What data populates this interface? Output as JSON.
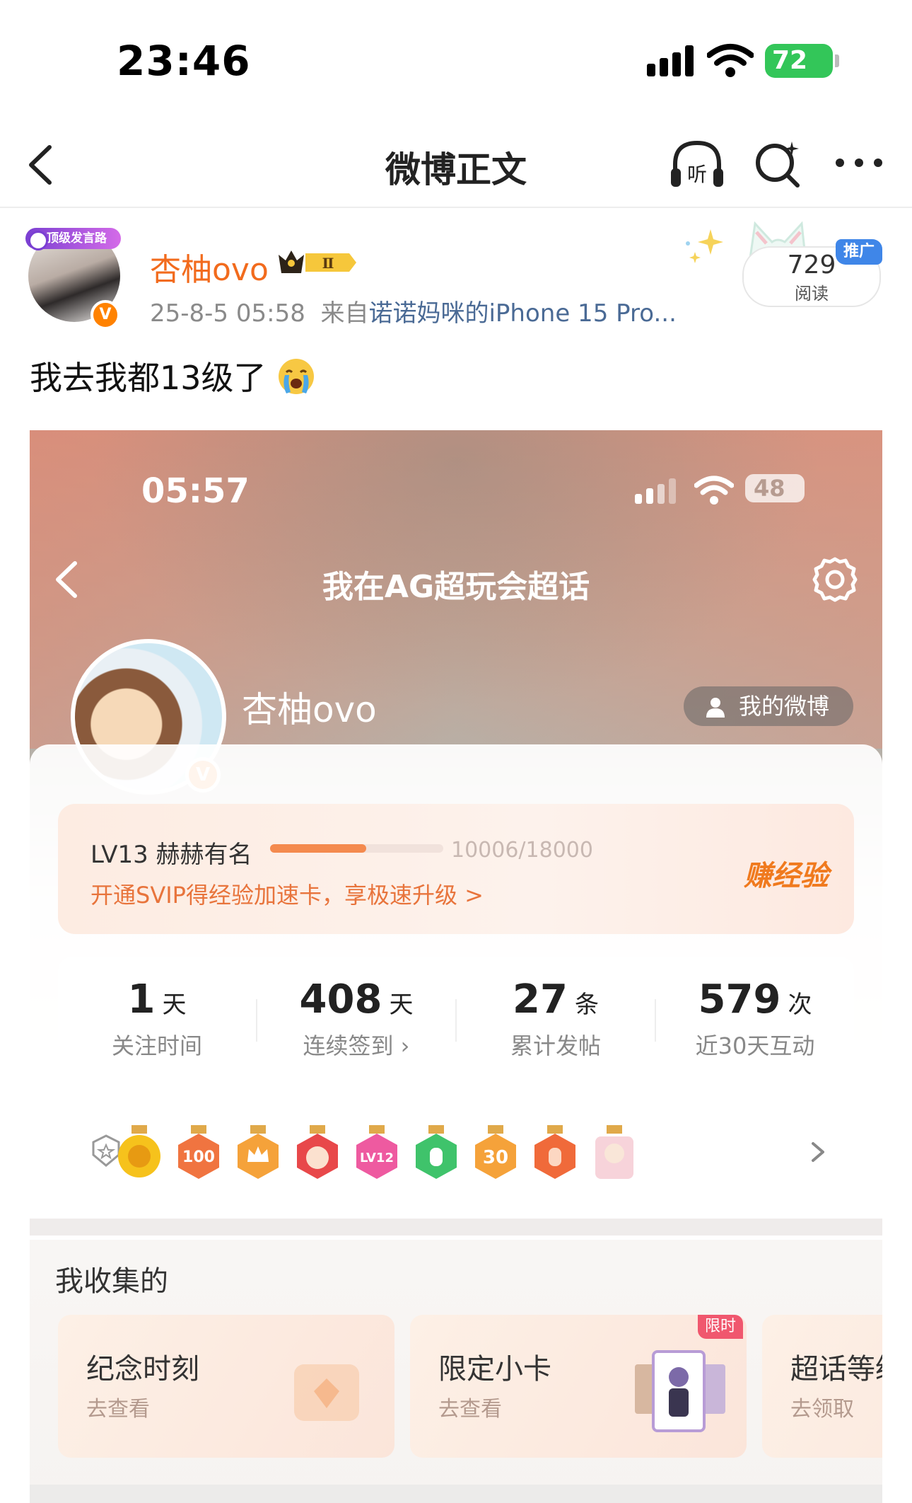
{
  "status_bar": {
    "time": "23:46",
    "battery": "72"
  },
  "nav": {
    "title": "微博正文"
  },
  "post": {
    "badge_top": "顶级发言路",
    "user_name": "杏柚ovo",
    "vip_level": "Ⅱ",
    "date": "25-8-5 05:58",
    "source_prefix": "来自",
    "source": "诺诺妈咪的iPhone 15 Pro...",
    "reads_count": "729",
    "reads_label": "阅读",
    "promo_label": "推广",
    "text": "我去我都13级了"
  },
  "shot": {
    "status": {
      "time": "05:57",
      "battery": "48"
    },
    "title": "我在AG超玩会超话",
    "user_name": "杏柚ovo",
    "my_weibo": "我的微博",
    "level": {
      "label": "LV13 赫赫有名",
      "progress_text": "10006/18000",
      "progress": 0.556,
      "svip_text": "开通SVIP得经验加速卡，享极速升级 >",
      "earn_label": "赚经验"
    },
    "stats": [
      {
        "num": "1",
        "unit": "天",
        "label": "关注时间"
      },
      {
        "num": "408",
        "unit": "天",
        "label": "连续签到 ›"
      },
      {
        "num": "27",
        "unit": "条",
        "label": "累计发帖"
      },
      {
        "num": "579",
        "unit": "次",
        "label": "近30天互动"
      }
    ],
    "medals": [
      "sun-medal",
      "100-days-medal",
      "crown-medal",
      "red-face-medal",
      "lv12-medal",
      "green-hand-medal",
      "30-days-medal",
      "orange-hand-medal",
      "character-medal"
    ],
    "collect_title": "我收集的",
    "collect_cards": [
      {
        "title": "纪念时刻",
        "sub": "去查看"
      },
      {
        "title": "限定小卡",
        "sub": "去查看"
      },
      {
        "title": "超话等级",
        "sub": "去领取"
      }
    ],
    "limit_tag": "限时"
  },
  "colors": {
    "accent": "#ff8200",
    "username": "#f26b1d",
    "link": "#4a6a95",
    "promo": "#3f86e8"
  }
}
